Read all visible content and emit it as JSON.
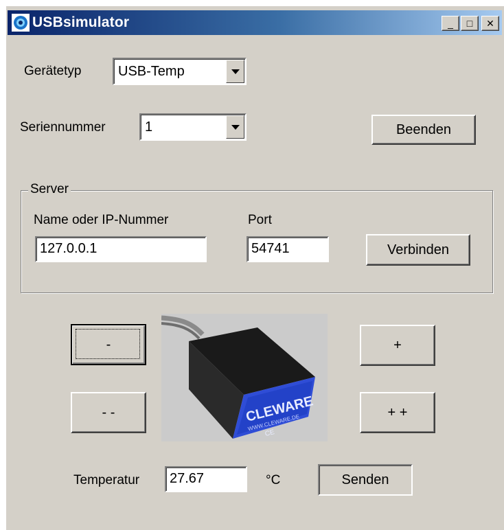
{
  "window": {
    "title": "USBsimulator",
    "controls": {
      "minimize": "_",
      "maximize": "□",
      "close": "✕"
    }
  },
  "device_type": {
    "label": "Gerätetyp",
    "value": "USB-Temp"
  },
  "serial": {
    "label": "Seriennummer",
    "value": "1"
  },
  "exit_button": "Beenden",
  "server": {
    "legend": "Server",
    "host_label": "Name oder IP-Nummer",
    "host_value": "127.0.0.1",
    "port_label": "Port",
    "port_value": "54741",
    "connect_button": "Verbinden"
  },
  "adjust": {
    "minus": "-",
    "minus_minus": "- -",
    "plus": "+",
    "plus_plus": "+ +"
  },
  "device_image": {
    "brand": "CLEWARE",
    "url": "WWW.CLEWARE.DE",
    "mark": "CE"
  },
  "temperature": {
    "label": "Temperatur",
    "value": "27.67",
    "unit": "°C",
    "send_button": "Senden"
  },
  "colors": {
    "face": "#d4d0c8",
    "title_start": "#0a246a",
    "title_end": "#a6caf0"
  }
}
